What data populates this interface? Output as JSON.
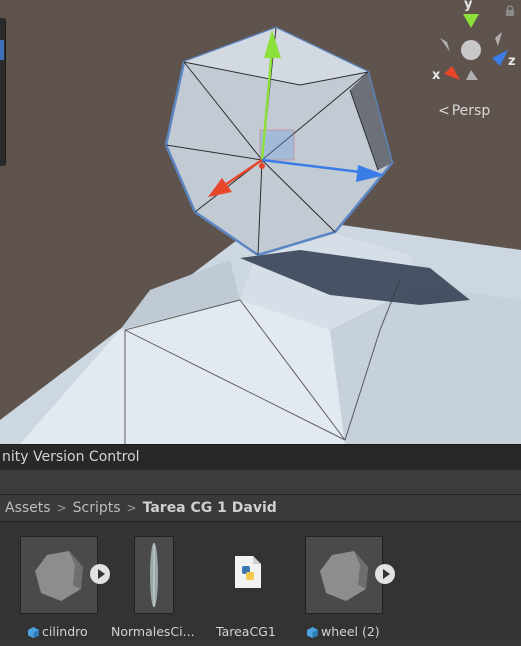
{
  "scene_view": {
    "projection_label": "Persp",
    "axes": {
      "x": "x",
      "y": "y",
      "z": "z"
    }
  },
  "panel": {
    "tab_label": "nity Version Control",
    "breadcrumb": [
      "Assets",
      "Scripts",
      "Tarea CG 1 David"
    ],
    "assets": [
      {
        "name": "cilindro",
        "kind": "model",
        "icon": "prefab-cube-icon"
      },
      {
        "name": "NormalesCi...",
        "kind": "model",
        "icon": ""
      },
      {
        "name": "TareaCG1",
        "kind": "python-script",
        "icon": "python-file-icon"
      },
      {
        "name": "wheel (2)",
        "kind": "model",
        "icon": "prefab-cube-icon"
      }
    ]
  },
  "colors": {
    "x_axis": "#e8452a",
    "y_axis": "#8be03a",
    "z_axis": "#3a7de8",
    "selection_outline": "#5b86c2"
  }
}
